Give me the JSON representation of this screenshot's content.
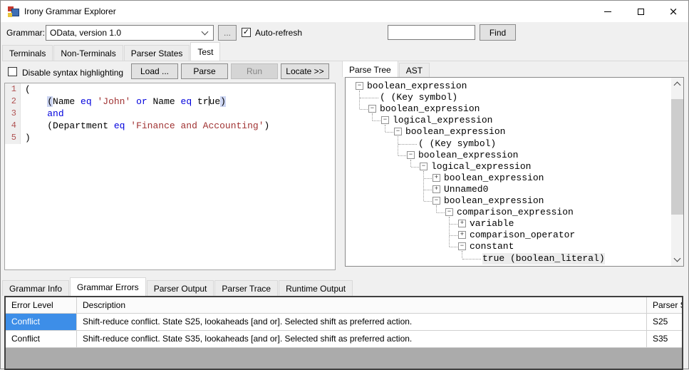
{
  "colors": {
    "sel-blue": "#3d8ee8",
    "keyword": "#0000dd",
    "string": "#a03232",
    "linenum": "#b05252",
    "bracket-hl": "#ccd5f2"
  },
  "window": {
    "title": "Irony Grammar Explorer",
    "close_glyph": "×"
  },
  "toolbar": {
    "grammar_label": "Grammar:",
    "grammar_value": "OData, version 1.0",
    "browse_label": "...",
    "auto_refresh": {
      "label": "Auto-refresh",
      "checked": true
    },
    "find": {
      "value": "",
      "button_label": "Find"
    }
  },
  "main_tabs": {
    "items": [
      "Terminals",
      "Non-Terminals",
      "Parser States",
      "Test"
    ],
    "active": "Test"
  },
  "test_panel": {
    "disable_syntax": {
      "label": "Disable syntax highlighting",
      "checked": false
    },
    "buttons": [
      {
        "label": "Load ...",
        "enabled": true
      },
      {
        "label": "Parse",
        "enabled": true
      },
      {
        "label": "Run",
        "enabled": false
      },
      {
        "label": "Locate >>",
        "enabled": true
      }
    ],
    "editor_lines": [
      {
        "num": "1",
        "segs": [
          {
            "t": "(",
            "c": "p"
          }
        ]
      },
      {
        "num": "2",
        "segs": [
          {
            "t": "    ",
            "c": "p"
          },
          {
            "t": "(",
            "c": "hb"
          },
          {
            "t": "Name ",
            "c": "p"
          },
          {
            "t": "eq",
            "c": "k"
          },
          {
            "t": " ",
            "c": "p"
          },
          {
            "t": "'John'",
            "c": "s"
          },
          {
            "t": " ",
            "c": "p"
          },
          {
            "t": "or",
            "c": "k"
          },
          {
            "t": " Name ",
            "c": "p"
          },
          {
            "t": "eq",
            "c": "k"
          },
          {
            "t": " tr",
            "c": "p"
          },
          {
            "t": "",
            "c": "caret"
          },
          {
            "t": "ue",
            "c": "p"
          },
          {
            "t": ")",
            "c": "hb"
          }
        ]
      },
      {
        "num": "3",
        "segs": [
          {
            "t": "    ",
            "c": "p"
          },
          {
            "t": "and",
            "c": "k"
          }
        ]
      },
      {
        "num": "4",
        "segs": [
          {
            "t": "    ",
            "c": "p"
          },
          {
            "t": "(Department ",
            "c": "p"
          },
          {
            "t": "eq",
            "c": "k"
          },
          {
            "t": " ",
            "c": "p"
          },
          {
            "t": "'Finance and Accounting'",
            "c": "s"
          },
          {
            "t": ")",
            "c": "p"
          }
        ]
      },
      {
        "num": "5",
        "segs": [
          {
            "t": ")",
            "c": "p"
          }
        ]
      }
    ]
  },
  "parse_panel": {
    "tabs": {
      "items": [
        "Parse Tree",
        "AST"
      ],
      "active": "Parse Tree"
    },
    "tree": [
      {
        "d": 0,
        "e": "minus",
        "label": "boolean_expression"
      },
      {
        "d": 1,
        "e": "leaf",
        "label": "( (Key symbol)"
      },
      {
        "d": 1,
        "e": "minus",
        "label": "boolean_expression"
      },
      {
        "d": 2,
        "e": "minus",
        "label": "logical_expression"
      },
      {
        "d": 3,
        "e": "minus",
        "label": "boolean_expression"
      },
      {
        "d": 4,
        "e": "leaf",
        "label": "( (Key symbol)"
      },
      {
        "d": 4,
        "e": "minus",
        "label": "boolean_expression"
      },
      {
        "d": 5,
        "e": "minus",
        "label": "logical_expression"
      },
      {
        "d": 6,
        "e": "plus",
        "label": "boolean_expression"
      },
      {
        "d": 6,
        "e": "plus",
        "label": "Unnamed0"
      },
      {
        "d": 6,
        "e": "minus",
        "label": "boolean_expression"
      },
      {
        "d": 7,
        "e": "minus",
        "label": "comparison_expression"
      },
      {
        "d": 8,
        "e": "plus",
        "label": "variable"
      },
      {
        "d": 8,
        "e": "plus",
        "label": "comparison_operator"
      },
      {
        "d": 8,
        "e": "minus",
        "label": "constant"
      },
      {
        "d": 9,
        "e": "leaf",
        "label": "true (boolean_literal)",
        "selected": true
      }
    ]
  },
  "bottom_tabs": {
    "items": [
      "Grammar Info",
      "Grammar Errors",
      "Parser Output",
      "Parser Trace",
      "Runtime Output"
    ],
    "active": "Grammar Errors"
  },
  "errors_grid": {
    "columns": [
      "Error Level",
      "Description",
      "Parser Sta"
    ],
    "rows": [
      {
        "cells": [
          "Conflict",
          "Shift-reduce conflict. State S25, lookaheads [and or]. Selected shift as preferred action.",
          "S25"
        ],
        "selected_cell": 0
      },
      {
        "cells": [
          "Conflict",
          "Shift-reduce conflict. State S35, lookaheads [and or]. Selected shift as preferred action.",
          "S35"
        ],
        "selected_cell": -1
      }
    ]
  }
}
